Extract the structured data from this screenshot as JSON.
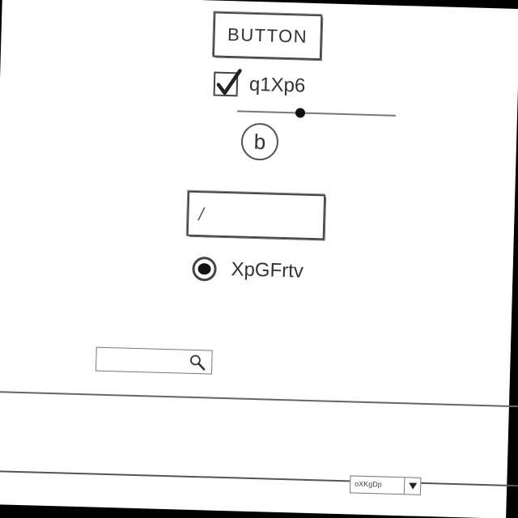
{
  "button": {
    "label": "BUTTON"
  },
  "checkbox": {
    "label": "q1Xp6",
    "checked": true
  },
  "slider": {
    "value": 0.4
  },
  "round_button": {
    "label": "b"
  },
  "text_field": {
    "value": "/"
  },
  "radio": {
    "label": "XpGFrtv",
    "selected": true
  },
  "search": {
    "value": ""
  },
  "dropdown": {
    "selected": "oXKgDp"
  },
  "colors": {
    "ink": "#333333",
    "stroke": "#444444",
    "paper": "#ffffff",
    "background": "#000000"
  },
  "icons": {
    "checkmark": "checkmark-icon",
    "search": "search-icon",
    "dropdown": "triangle-down-icon"
  }
}
